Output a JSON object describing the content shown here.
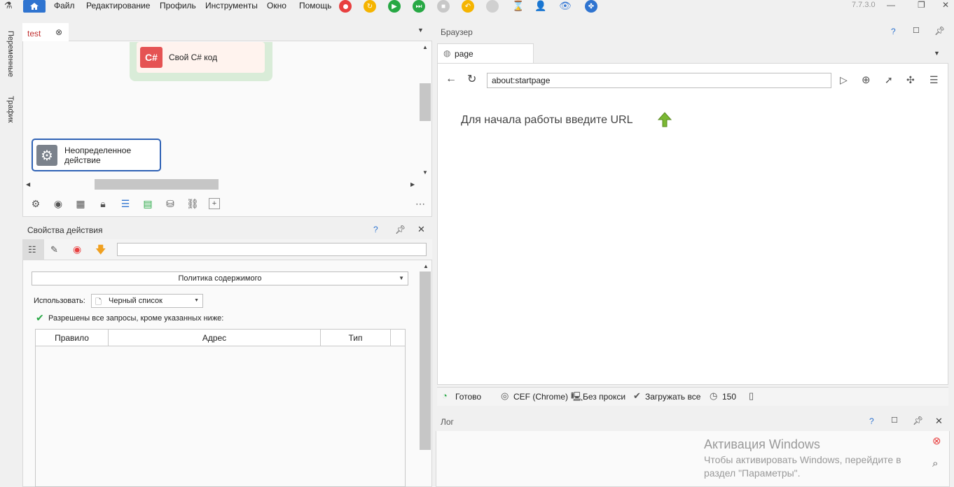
{
  "menu": {
    "items": [
      "Файл",
      "Редактирование",
      "Профиль",
      "Инструменты",
      "Окно",
      "Помощь"
    ],
    "version": "7.7.3.0"
  },
  "left_strip": {
    "variables": "Переменные",
    "traffic": "Трафик"
  },
  "editor": {
    "tab_label": "test",
    "node_csharp": {
      "badge": "C#",
      "label": "Свой C# код"
    },
    "node_undefined": {
      "label_line1": "Неопределенное",
      "label_line2": "действие"
    }
  },
  "properties": {
    "title": "Свойства действия",
    "help": "?",
    "section_dropdown": "Политика содержимого",
    "use_label": "Использовать:",
    "use_value": "Черный список",
    "info_text": "Разрешены все запросы, кроме указанных ниже:",
    "columns": [
      "Правило",
      "Адрес",
      "Тип"
    ]
  },
  "browser": {
    "title": "Браузер",
    "help": "?",
    "tab_label": "page",
    "url": "about:startpage",
    "start_hint": "Для начала работы введите URL",
    "status": {
      "ready": "Готово",
      "engine": "CEF (Chrome)",
      "proxy": "Без прокси",
      "load": "Загружать все",
      "timeout": "150"
    }
  },
  "log": {
    "title": "Лог",
    "help": "?",
    "watermark_title": "Активация Windows",
    "watermark_line1": "Чтобы активировать Windows, перейдите в",
    "watermark_line2": "раздел \"Параметры\"."
  },
  "colors": {
    "accent": "#2f74d0",
    "csharp": "#e55353",
    "green": "#5cb85c"
  }
}
